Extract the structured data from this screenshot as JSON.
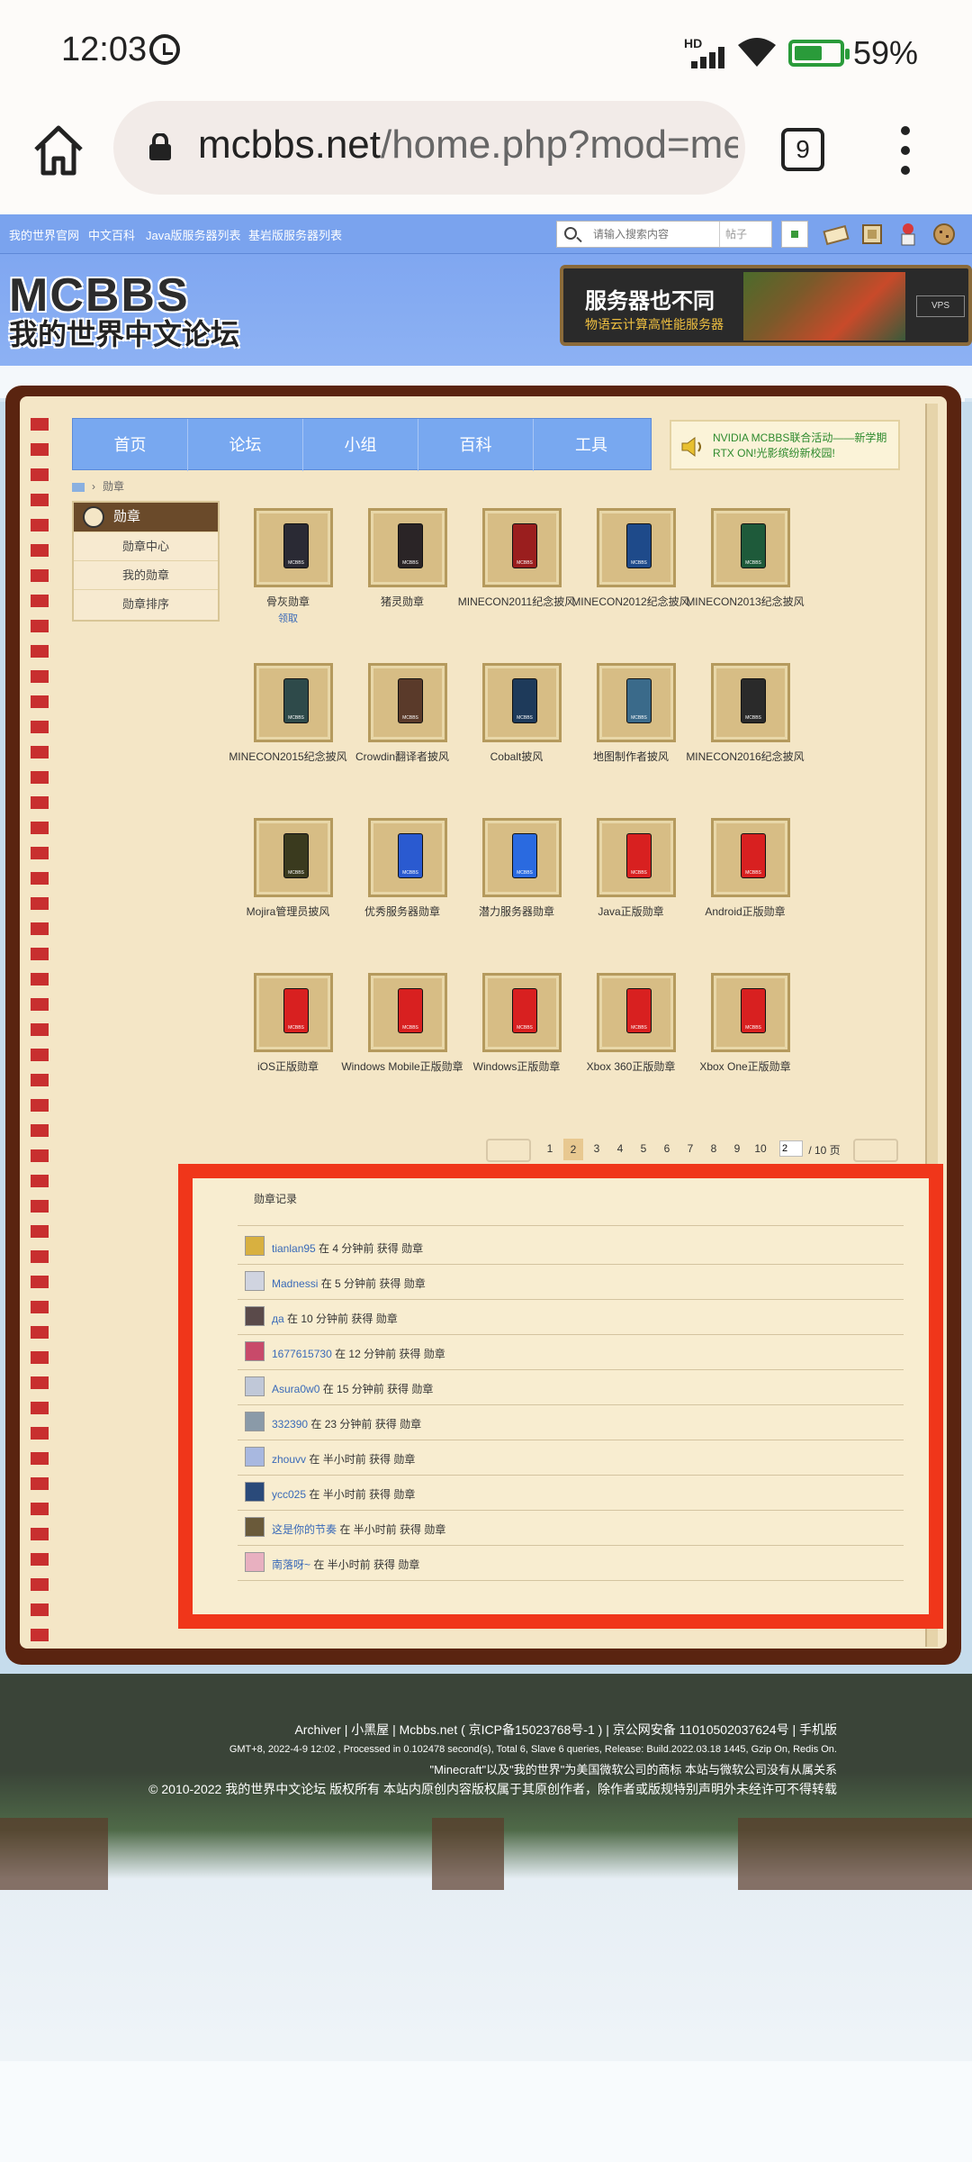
{
  "status_bar": {
    "time": "12:03",
    "network": "HD",
    "battery": "59%"
  },
  "browser": {
    "url_host": "mcbbs.net",
    "url_path": "/home.php?mod=me",
    "tab_count": "9"
  },
  "topnav": {
    "links": [
      "我的世界官网",
      "中文百科",
      "Java版服务器列表",
      "基岩版服务器列表"
    ],
    "search_placeholder": "请输入搜索内容",
    "search_scope": "帖子"
  },
  "logo": {
    "big": "MCBBS",
    "sub": "我的世界中文论坛"
  },
  "ad": {
    "title": "服务器也不同",
    "subtitle": "物语云计算高性能服务器",
    "tag": "VPS"
  },
  "mainnav": [
    "首页",
    "论坛",
    "小组",
    "百科",
    "工具"
  ],
  "notice": "NVIDIA MCBBS联合活动——新学期 RTX ON!光影缤纷新校园!",
  "breadcrumb": "勋章",
  "sidebar": {
    "title": "勋章",
    "items": [
      "勋章中心",
      "我的勋章",
      "勋章排序"
    ]
  },
  "medals": [
    {
      "name": "骨灰勋章",
      "claim": "领取",
      "color": "#2a2a34"
    },
    {
      "name": "猪灵勋章",
      "color": "#2a2426"
    },
    {
      "name": "MINECON2011纪念披风",
      "color": "#9a1e1e"
    },
    {
      "name": "MINECON2012纪念披风",
      "color": "#1e4a8a"
    },
    {
      "name": "MINECON2013纪念披风",
      "color": "#1e5a3a"
    },
    {
      "name": "MINECON2015纪念披风",
      "color": "#2e4a4a"
    },
    {
      "name": "Crowdin翻译者披风",
      "color": "#5a3a2a"
    },
    {
      "name": "Cobalt披风",
      "color": "#1e3a5a"
    },
    {
      "name": "地图制作者披风",
      "color": "#3a6a8a"
    },
    {
      "name": "MINECON2016纪念披风",
      "color": "#2a2a2a"
    },
    {
      "name": "Mojira管理员披风",
      "color": "#3a3a1e"
    },
    {
      "name": "优秀服务器勋章",
      "color": "#2a5ad0"
    },
    {
      "name": "潜力服务器勋章",
      "color": "#2a6ae0"
    },
    {
      "name": "Java正版勋章",
      "color": "#d82020"
    },
    {
      "name": "Android正版勋章",
      "color": "#d82020"
    },
    {
      "name": "iOS正版勋章",
      "color": "#d82020"
    },
    {
      "name": "Windows Mobile正版勋章",
      "color": "#d82020"
    },
    {
      "name": "Windows正版勋章",
      "color": "#d82020"
    },
    {
      "name": "Xbox 360正版勋章",
      "color": "#d82020"
    },
    {
      "name": "Xbox One正版勋章",
      "color": "#d82020"
    }
  ],
  "pager": {
    "pages": [
      "1",
      "2",
      "3",
      "4",
      "5",
      "6",
      "7",
      "8",
      "9",
      "10"
    ],
    "current": "2",
    "input": "2",
    "total": "/ 10 页"
  },
  "record": {
    "title": "勋章记录",
    "rows": [
      {
        "user": "tianlan95",
        "text": " 在 4 分钟前 获得 勋章",
        "avatar_color": "#d8b040"
      },
      {
        "user": "Madnessi",
        "text": " 在 5 分钟前 获得 勋章",
        "avatar_color": "#d0d4e0"
      },
      {
        "user": "да",
        "text": " 在 10 分钟前 获得 勋章",
        "avatar_color": "#5a4a4a"
      },
      {
        "user": "1677615730",
        "text": " 在 12 分钟前 获得 勋章",
        "avatar_color": "#c84a6a"
      },
      {
        "user": "Asura0w0",
        "text": " 在 15 分钟前 获得 勋章",
        "avatar_color": "#c0c8d8"
      },
      {
        "user": "332390",
        "text": " 在 23 分钟前 获得 勋章",
        "avatar_color": "#8a9aa8"
      },
      {
        "user": "zhouvv",
        "text": " 在 半小时前 获得 勋章",
        "avatar_color": "#a8b8e0"
      },
      {
        "user": "ycc025",
        "text": " 在 半小时前 获得 勋章",
        "avatar_color": "#2a4a7a"
      },
      {
        "user": "这是你的节奏",
        "text": " 在 半小时前 获得 勋章",
        "avatar_color": "#6a5a3a"
      },
      {
        "user": "南落呀~",
        "text": " 在 半小时前 获得 勋章",
        "avatar_color": "#e8b0c0"
      }
    ]
  },
  "footer": {
    "line1": "Archiver | 小黑屋 | Mcbbs.net ( 京ICP备15023768号-1 ) | 京公网安备 11010502037624号 | 手机版",
    "line2": "GMT+8, 2022-4-9 12:02 , Processed in 0.102478 second(s), Total 6, Slave 6 queries, Release: Build.2022.03.18 1445, Gzip On, Redis On.",
    "line3": "\"Minecraft\"以及\"我的世界\"为美国微软公司的商标 本站与微软公司没有从属关系",
    "line4": "© 2010-2022 我的世界中文论坛 版权所有 本站内原创内容版权属于其原创作者，除作者或版规特别声明外未经许可不得转载"
  }
}
